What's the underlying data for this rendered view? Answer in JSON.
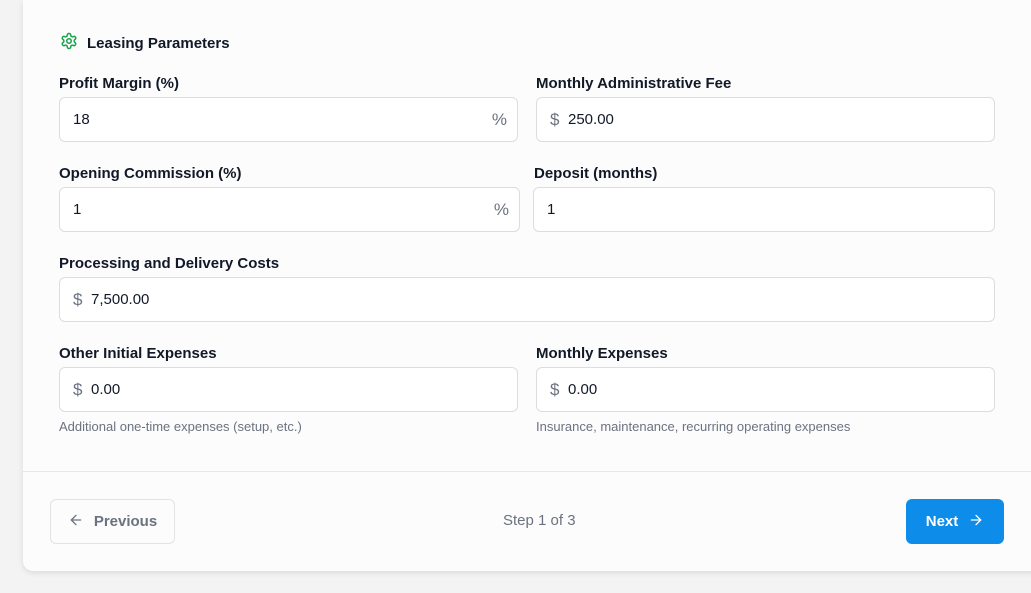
{
  "section": {
    "title": "Leasing Parameters",
    "icon": "gear-icon",
    "accent": "#16a34a"
  },
  "fields": {
    "profit_margin": {
      "label": "Profit Margin (%)",
      "value": "18",
      "suffix": "%"
    },
    "monthly_admin_fee": {
      "label": "Monthly Administrative Fee",
      "prefix": "$",
      "value": "250.00"
    },
    "opening_commission": {
      "label": "Opening Commission (%)",
      "value": "1",
      "suffix": "%"
    },
    "deposit_months": {
      "label": "Deposit (months)",
      "value": "1"
    },
    "processing_delivery": {
      "label": "Processing and Delivery Costs",
      "prefix": "$",
      "value": "7,500.00"
    },
    "other_initial": {
      "label": "Other Initial Expenses",
      "prefix": "$",
      "value": "0.00",
      "hint": "Additional one-time expenses (setup, etc.)"
    },
    "monthly_expenses": {
      "label": "Monthly Expenses",
      "prefix": "$",
      "value": "0.00",
      "hint": "Insurance, maintenance, recurring operating expenses"
    }
  },
  "footer": {
    "previous_label": "Previous",
    "step_text": "Step 1 of 3",
    "next_label": "Next",
    "next_color": "#0e8cea"
  }
}
